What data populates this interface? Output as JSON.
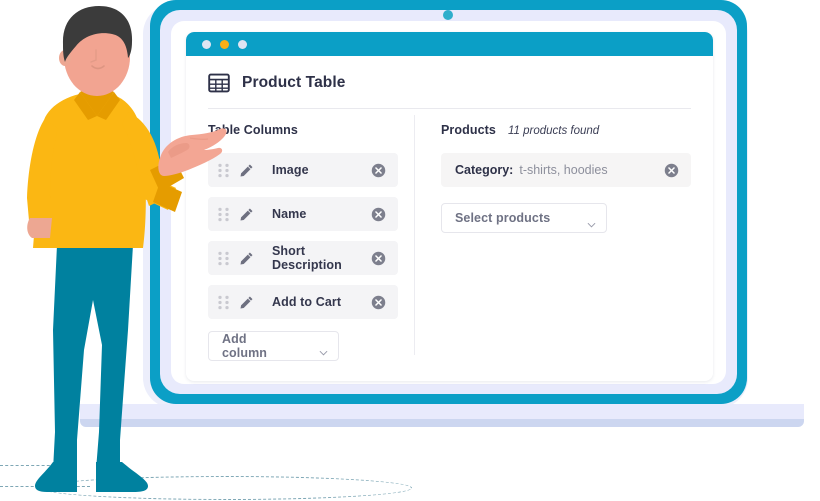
{
  "window": {
    "dots": [
      "window-dot-grey",
      "window-dot-amber",
      "window-dot-grey"
    ],
    "title": "Product Table",
    "title_icon": "table-grid-icon"
  },
  "columns_panel": {
    "title": "Table Columns",
    "rows": [
      {
        "label": "Image",
        "drag_icon": "drag-handle-icon",
        "edit_icon": "pencil-icon",
        "remove_icon": "remove-circle-icon"
      },
      {
        "label": "Name",
        "drag_icon": "drag-handle-icon",
        "edit_icon": "pencil-icon",
        "remove_icon": "remove-circle-icon"
      },
      {
        "label": "Short Description",
        "drag_icon": "drag-handle-icon",
        "edit_icon": "pencil-icon",
        "remove_icon": "remove-circle-icon"
      },
      {
        "label": "Add to Cart",
        "drag_icon": "drag-handle-icon",
        "edit_icon": "pencil-icon",
        "remove_icon": "remove-circle-icon"
      }
    ],
    "add_column": {
      "label": "Add column",
      "caret_icon": "chevron-down-icon"
    }
  },
  "products_panel": {
    "title": "Products",
    "count_text": "11 products found",
    "filter": {
      "key": "Category:",
      "value": "t-shirts, hoodies",
      "remove_icon": "remove-circle-icon"
    },
    "select_products": {
      "label": "Select products",
      "caret_icon": "chevron-down-icon"
    }
  },
  "colors": {
    "accent_cyan": "#0b9fc6",
    "amber": "#fbaf17",
    "lavender": "#e8eafc",
    "base_strip": "#ccd6f0",
    "row_bg": "#f4f4f6",
    "text_dark": "#2e3148",
    "text_muted": "#8d8f9c",
    "shirt_yellow": "#fbb713",
    "pants_teal": "#00819f",
    "skin": "#f2a08d",
    "hair": "#3b3b3b"
  }
}
